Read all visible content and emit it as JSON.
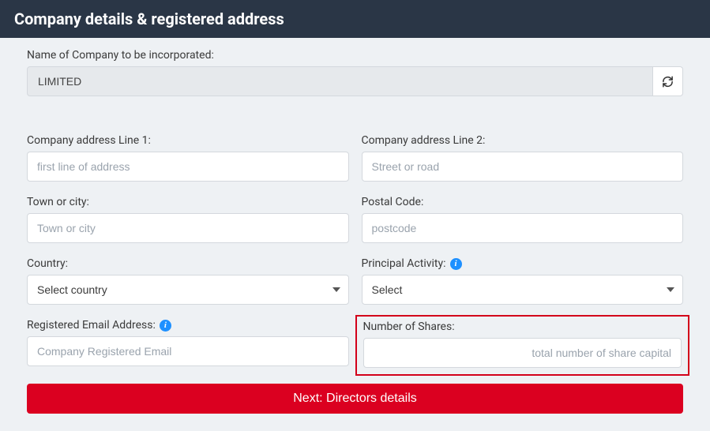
{
  "header": {
    "title": "Company details & registered address"
  },
  "company_name": {
    "label": "Name of Company to be incorporated:",
    "value": "LIMITED"
  },
  "addr1": {
    "label": "Company address Line 1:",
    "placeholder": "first line of address"
  },
  "addr2": {
    "label": "Company address Line 2:",
    "placeholder": "Street or road"
  },
  "town": {
    "label": "Town or city:",
    "placeholder": "Town or city"
  },
  "postal": {
    "label": "Postal Code:",
    "placeholder": "postcode"
  },
  "country": {
    "label": "Country:",
    "selected": "Select country"
  },
  "activity": {
    "label": "Principal Activity:",
    "selected": "Select"
  },
  "email": {
    "label": "Registered Email Address:",
    "placeholder": "Company Registered Email"
  },
  "shares": {
    "label": "Number of Shares:",
    "placeholder": "total number of share capital"
  },
  "next_button": {
    "label": "Next: Directors details"
  }
}
